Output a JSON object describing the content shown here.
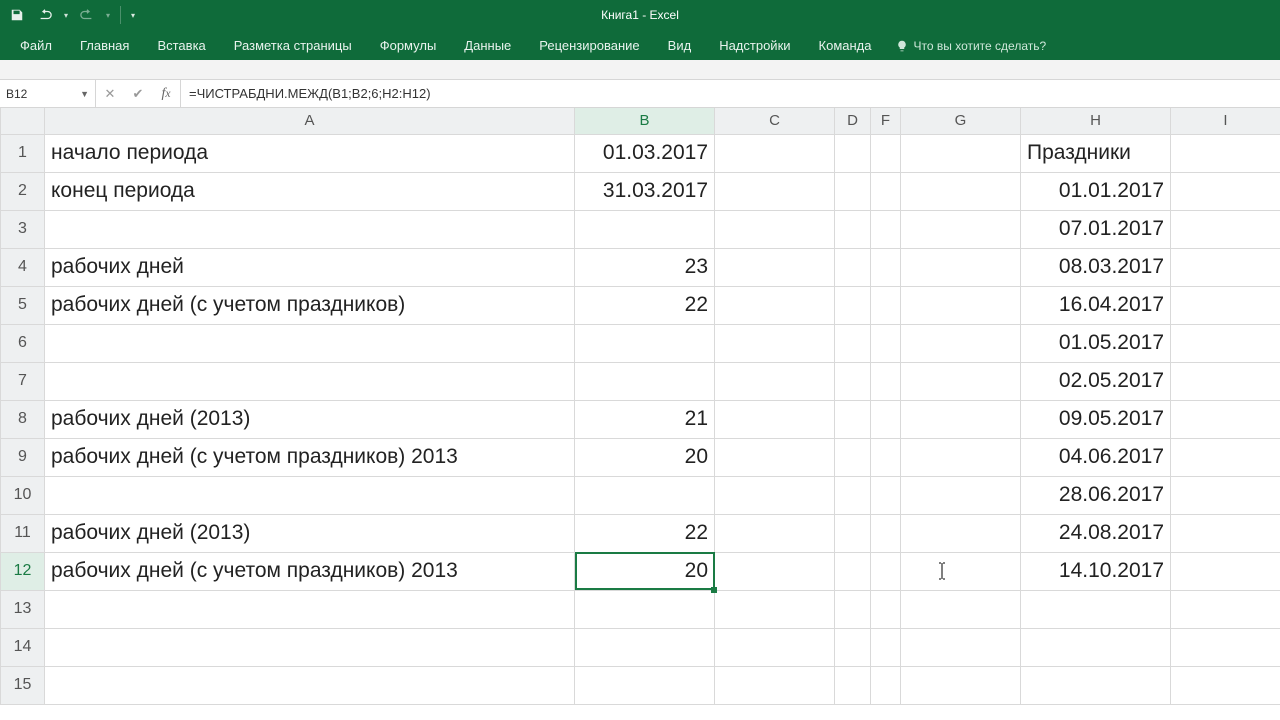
{
  "app": {
    "title": "Книга1  -  Excel"
  },
  "ribbon": {
    "tabs": [
      "Файл",
      "Главная",
      "Вставка",
      "Разметка страницы",
      "Формулы",
      "Данные",
      "Рецензирование",
      "Вид",
      "Надстройки",
      "Команда"
    ],
    "tellme": "Что вы хотите сделать?"
  },
  "formula_bar": {
    "name_box": "B12",
    "formula": "=ЧИСТРАБДНИ.МЕЖД(B1;B2;6;H2:H12)"
  },
  "columns": [
    "A",
    "B",
    "C",
    "D",
    "F",
    "G",
    "H",
    "I"
  ],
  "cells": {
    "A1": "начало периода",
    "B1": "01.03.2017",
    "A2": "конец периода",
    "B2": "31.03.2017",
    "A4": "рабочих дней",
    "B4": "23",
    "A5": "рабочих дней (с учетом праздников)",
    "B5": "22",
    "A8": "рабочих дней (2013)",
    "B8": "21",
    "A9": "рабочих дней (с учетом праздников) 2013",
    "B9": "20",
    "A11": "рабочих дней (2013)",
    "B11": "22",
    "A12": "рабочих дней (с учетом праздников) 2013",
    "B12": "20",
    "H1": "Праздники",
    "H2": "01.01.2017",
    "H3": "07.01.2017",
    "H4": "08.03.2017",
    "H5": "16.04.2017",
    "H6": "01.05.2017",
    "H7": "02.05.2017",
    "H8": "09.05.2017",
    "H9": "04.06.2017",
    "H10": "28.06.2017",
    "H11": "24.08.2017",
    "H12": "14.10.2017"
  },
  "row_labels": [
    "1",
    "2",
    "3",
    "4",
    "5",
    "6",
    "7",
    "8",
    "9",
    "10",
    "11",
    "12",
    "13",
    "14",
    "15"
  ],
  "selection": {
    "cell": "B12",
    "row": 12,
    "col": "B"
  }
}
